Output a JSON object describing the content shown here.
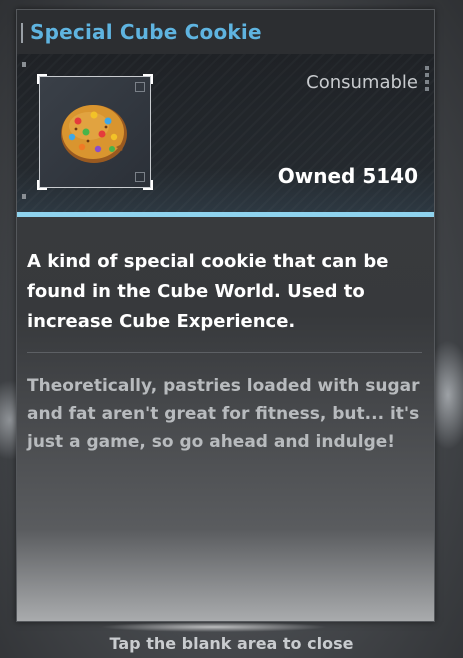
{
  "item": {
    "name": "Special Cube Cookie",
    "type": "Consumable",
    "owned_label": "Owned",
    "owned_count": "5140",
    "icon": "cookie-icon",
    "description": "A kind of special cookie that can be found in the Cube World. Used to increase Cube Experience.",
    "flavor_text": "Theoretically, pastries loaded with sugar and fat aren't great for fitness, but... it's just a game, so go ahead and indulge!"
  },
  "footer": {
    "close_hint": "Tap the blank area to close"
  },
  "colors": {
    "title": "#5fb4e0",
    "accent_stripe": "#8fd3ee",
    "panel_bg": "#37393c"
  }
}
